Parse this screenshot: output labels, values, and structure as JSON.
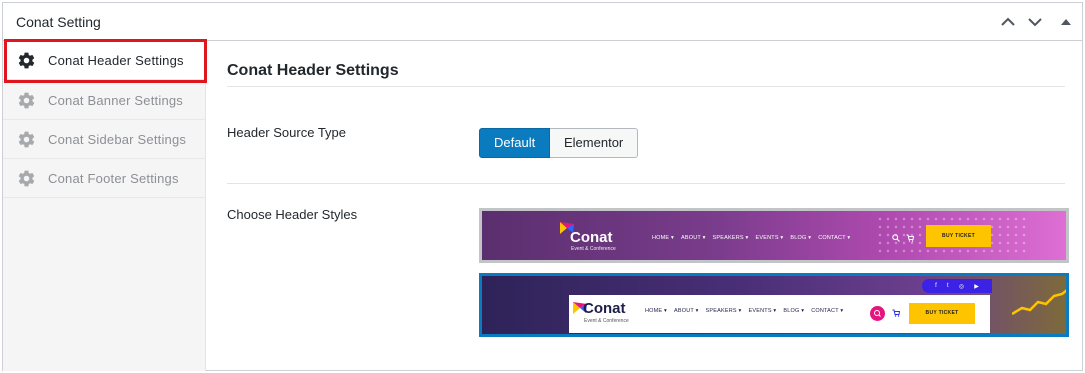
{
  "panel": {
    "title": "Conat Setting",
    "controls": [
      "chevron-up-icon",
      "chevron-down-icon",
      "caret-up-icon"
    ]
  },
  "sidebar": {
    "items": [
      {
        "label": "Conat Header Settings",
        "active": true,
        "icon": "gear-icon"
      },
      {
        "label": "Conat Banner Settings",
        "active": false,
        "icon": "gear-icon"
      },
      {
        "label": "Conat Sidebar Settings",
        "active": false,
        "icon": "gear-icon"
      },
      {
        "label": "Conat Footer Settings",
        "active": false,
        "icon": "gear-icon"
      }
    ],
    "highlight_color": "#e0151d"
  },
  "main": {
    "title": "Conat Header Settings",
    "header_source": {
      "label": "Header Source Type",
      "options": [
        "Default",
        "Elementor"
      ],
      "selected": "Default"
    },
    "header_styles": {
      "label": "Choose Header Styles",
      "selected_index": 1,
      "previews": [
        {
          "logo": "Conat",
          "logo_sub": "Event & Conference",
          "menu": [
            "HOME ▾",
            "ABOUT ▾",
            "SPEAKERS ▾",
            "EVENTS ▾",
            "BLOG ▾",
            "CONTACT ▾"
          ],
          "button": "BUY TICKET"
        },
        {
          "logo": "Conat",
          "logo_sub": "Event & Conference",
          "menu": [
            "HOME ▾",
            "ABOUT ▾",
            "SPEAKERS ▾",
            "EVENTS ▾",
            "BLOG ▾",
            "CONTACT ▾"
          ],
          "button": "BUY TICKET",
          "social": [
            "f",
            "t",
            "◎",
            "▶"
          ]
        }
      ]
    }
  },
  "colors": {
    "primary": "#0a7bbf",
    "accent_yellow": "#ffc400",
    "accent_pink": "#e6157d"
  }
}
